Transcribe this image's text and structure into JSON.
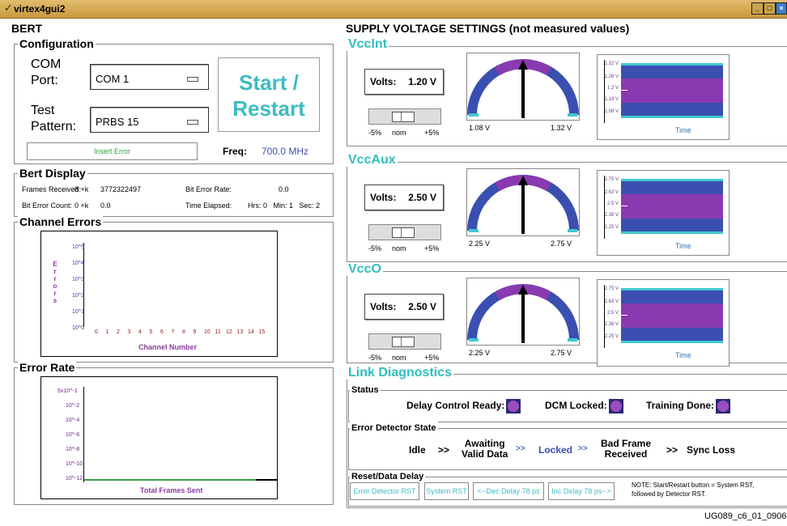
{
  "window": {
    "title": "virtex4gui2"
  },
  "bert": {
    "header": "BERT",
    "configuration": {
      "legend": "Configuration",
      "com_port_label": "COM\nPort:",
      "com_port_value": "COM 1",
      "test_pattern_label": "Test\nPattern:",
      "test_pattern_value": "PRBS 15",
      "start_label": "Start /\nRestart",
      "insert_error_label": "Insert Error",
      "freq_label": "Freq:",
      "freq_value": "700.0 MHz"
    },
    "display": {
      "legend": "Bert Display",
      "frames_received_label": "Frames Received:",
      "frames_received_k": "8 +k",
      "frames_received_value": "3772322497",
      "bit_error_rate_label": "Bit Error Rate:",
      "bit_error_rate_value": "0.0",
      "bit_error_count_label": "Bit Error Count:",
      "bit_error_count_k": "0 +k",
      "bit_error_count_value": "0.0",
      "time_elapsed_label": "Time Elapsed:",
      "time_elapsed_value": "Hrs: 0   Min: 1   Sec: 2"
    },
    "channel_errors": {
      "legend": "Channel Errors",
      "ylabel": "Errors",
      "xlabel": "Channel Number",
      "yticks": [
        "10^5",
        "10^4",
        "10^3",
        "10^2",
        "10^1",
        "10^0"
      ],
      "xticks": [
        "0",
        "1",
        "2",
        "3",
        "4",
        "5",
        "6",
        "7",
        "8",
        "9",
        "10",
        "11",
        "12",
        "13",
        "14",
        "15"
      ]
    },
    "error_rate": {
      "legend": "Error Rate",
      "xlabel": "Total Frames Sent",
      "yticks": [
        "5x10^-1",
        "10^-2",
        "10^-4",
        "10^-6",
        "10^-8",
        "10^-10",
        "10^-12"
      ]
    }
  },
  "supply": {
    "header": "SUPPLY VOLTAGE SETTINGS (not measured values)",
    "rails": [
      {
        "name": "VccInt",
        "volts_label": "Volts:",
        "volts_value": "1.20 V",
        "min": "1.08 V",
        "max": "1.32 V",
        "trend_labels": [
          "1.32 V",
          "1.26 V",
          "1.2 V",
          "1.14 V",
          "1.08 V"
        ],
        "time_label": "Time"
      },
      {
        "name": "VccAux",
        "volts_label": "Volts:",
        "volts_value": "2.50 V",
        "min": "2.25 V",
        "max": "2.75 V",
        "trend_labels": [
          "2.75 V",
          "2.63 V",
          "2.5 V",
          "2.38 V",
          "2.25 V"
        ],
        "time_label": "Time"
      },
      {
        "name": "VccO",
        "volts_label": "Volts:",
        "volts_value": "2.50 V",
        "min": "2.25 V",
        "max": "2.75 V",
        "trend_labels": [
          "2.75 V",
          "2.63 V",
          "2.5 V",
          "2.38 V",
          "2.25 V"
        ],
        "time_label": "Time"
      }
    ],
    "slider_labels": {
      "minus": "-5%",
      "nom": "nom",
      "plus": "+5%"
    }
  },
  "link": {
    "legend": "Link Diagnostics",
    "status": {
      "legend": "Status",
      "delay_control": "Delay Control Ready:",
      "dcm_locked": "DCM Locked:",
      "training_done": "Training Done:"
    },
    "error_detector": {
      "legend": "Error Detector State",
      "idle": "Idle",
      "arrow1": ">>",
      "awaiting": "Awaiting\nValid Data",
      "arrow2": ">>",
      "locked": "Locked",
      "arrow3": ">>",
      "bad_frame": "Bad Frame\nReceived",
      "arrow4": ">>",
      "sync_loss": "Sync Loss"
    },
    "reset": {
      "legend": "Reset/Data Delay",
      "error_detector_rst": "Error Detector RST",
      "system_rst": "System RST",
      "dec_delay": "<--Dec Delay 78 ps",
      "inc_delay": "Inc Delay 78 ps-->",
      "note": "NOTE: Start/Restart button = System RST,\nfollowed by Detector RST."
    }
  },
  "caption": "UG089_c6_01_090605",
  "colors": {
    "accent_cyan": "#2fbfc0",
    "gauge_blue": "#3a4fb0",
    "gauge_purple": "#8a3ab0",
    "led_purple": "#9b4cc1"
  }
}
